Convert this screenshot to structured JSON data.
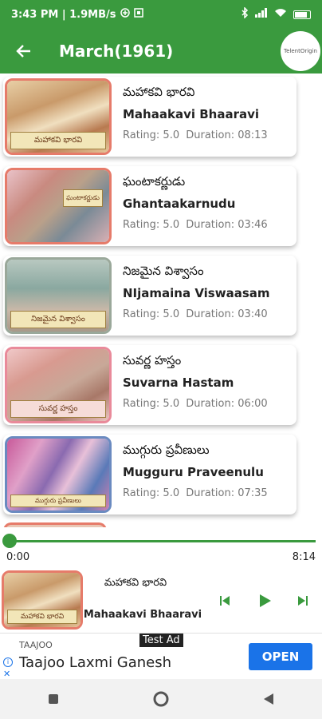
{
  "status_bar": {
    "time_speed": "3:43 PM | 1.9MB/s",
    "icons": [
      "data-saver-icon",
      "screenshot-icon",
      "bluetooth-icon",
      "signal-icon",
      "wifi-icon",
      "battery-icon"
    ]
  },
  "app_bar": {
    "title": "March(1961)",
    "logo_text": "TelentOrigin",
    "colors": {
      "primary": "#3a9a3e",
      "accent_border": "#e67b6a"
    }
  },
  "stories": [
    {
      "title_te": "మహాకవి భారవి",
      "title_en": "Mahaakavi Bhaaravi",
      "rating_label": "Rating: 5.0",
      "duration_label": "Duration: 08:13",
      "caption": "మహాకవి భారవి"
    },
    {
      "title_te": "ఘంటాకర్ణుడు",
      "title_en": "Ghantaakarnudu",
      "rating_label": "Rating: 5.0",
      "duration_label": "Duration: 03:46",
      "caption": "ఘంటాకర్ణుడు"
    },
    {
      "title_te": "నిజమైన విశ్వాసం",
      "title_en": "NIjamaina Viswaasam",
      "rating_label": "Rating: 5.0",
      "duration_label": "Duration: 03:40",
      "caption": "నిజమైన విశ్వాసం"
    },
    {
      "title_te": "సువర్ణ హస్తం",
      "title_en": "Suvarna Hastam",
      "rating_label": "Rating: 5.0",
      "duration_label": "Duration: 06:00",
      "caption": "సువర్ణ హస్తం"
    },
    {
      "title_te": "ముగ్గురు ప్రవీణులు",
      "title_en": "Mugguru Praveenulu",
      "rating_label": "Rating: 5.0",
      "duration_label": "Duration: 07:35",
      "caption": "ముగ్గురు ప్రవీణులు"
    }
  ],
  "player": {
    "elapsed": "0:00",
    "total": "8:14",
    "progress": 0.0,
    "title_te": "మహాకవి భారవి",
    "title_en": "Mahaakavi Bhaaravi",
    "caption": "మహాకవి భారవి"
  },
  "ad": {
    "tag": "Test Ad",
    "brand": "TAAJOO",
    "title": "Taajoo Laxmi Ganesh",
    "cta": "OPEN"
  }
}
